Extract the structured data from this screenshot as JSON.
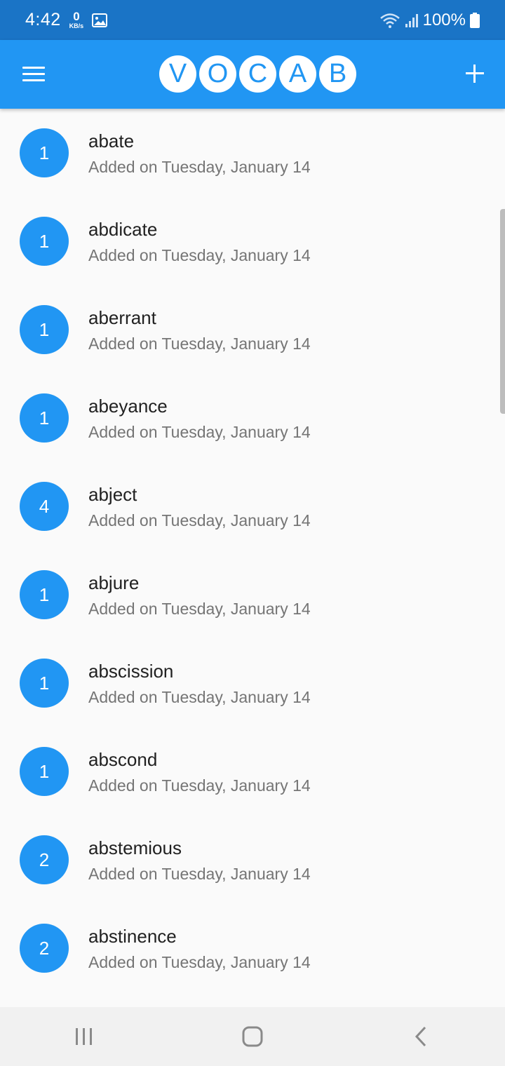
{
  "status_bar": {
    "time": "4:42",
    "speed_value": "0",
    "speed_unit": "KB/s",
    "battery": "100%"
  },
  "app_bar": {
    "logo_letters": [
      "V",
      "O",
      "C",
      "A",
      "B"
    ]
  },
  "words": [
    {
      "word": "abate",
      "count": "1",
      "subtitle": "Added on Tuesday, January 14"
    },
    {
      "word": "abdicate",
      "count": "1",
      "subtitle": "Added on Tuesday, January 14"
    },
    {
      "word": "aberrant",
      "count": "1",
      "subtitle": "Added on Tuesday, January 14"
    },
    {
      "word": "abeyance",
      "count": "1",
      "subtitle": "Added on Tuesday, January 14"
    },
    {
      "word": "abject",
      "count": "4",
      "subtitle": "Added on Tuesday, January 14"
    },
    {
      "word": "abjure",
      "count": "1",
      "subtitle": "Added on Tuesday, January 14"
    },
    {
      "word": "abscission",
      "count": "1",
      "subtitle": "Added on Tuesday, January 14"
    },
    {
      "word": "abscond",
      "count": "1",
      "subtitle": "Added on Tuesday, January 14"
    },
    {
      "word": "abstemious",
      "count": "2",
      "subtitle": "Added on Tuesday, January 14"
    },
    {
      "word": "abstinence",
      "count": "2",
      "subtitle": "Added on Tuesday, January 14"
    }
  ],
  "colors": {
    "primary": "#2196f3",
    "status_bar": "#1a74c6"
  }
}
